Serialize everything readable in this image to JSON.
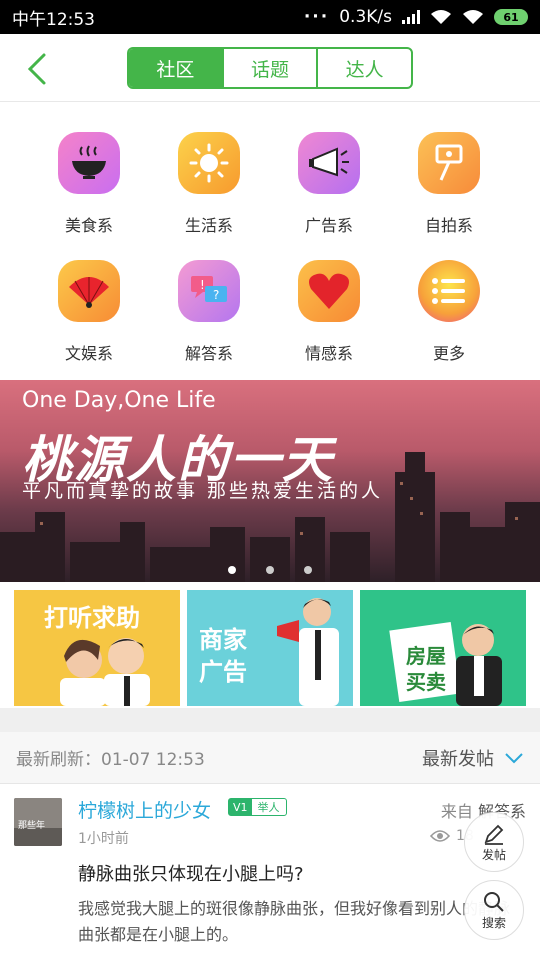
{
  "status_bar": {
    "time": "中午12:53",
    "dots": "···",
    "speed": "0.3K/s",
    "battery": "61"
  },
  "header": {
    "tabs": [
      "社区",
      "话题",
      "达人"
    ],
    "active_tab": "社区"
  },
  "categories": [
    {
      "label": "美食系",
      "icon": "food-bowl-icon"
    },
    {
      "label": "生活系",
      "icon": "sun-icon"
    },
    {
      "label": "广告系",
      "icon": "megaphone-icon"
    },
    {
      "label": "自拍系",
      "icon": "selfie-stick-icon"
    },
    {
      "label": "文娱系",
      "icon": "fan-icon"
    },
    {
      "label": "解答系",
      "icon": "chat-bubbles-icon"
    },
    {
      "label": "情感系",
      "icon": "heart-icon"
    },
    {
      "label": "更多",
      "icon": "list-icon"
    }
  ],
  "banner": {
    "title_en": "One Day,One Life",
    "title_cn": "桃源人的一天",
    "subtitle": "平凡而真挚的故事  那些热爱生活的人",
    "pages": 3,
    "active_page": 1
  },
  "promos": [
    {
      "label": "打听求助"
    },
    {
      "label_line1": "商家",
      "label_line2": "广告"
    },
    {
      "label_line1": "房屋",
      "label_line2": "买卖"
    }
  ],
  "feed_header": {
    "refresh_label": "最新刷新：01-07 12:53",
    "sort_label": "最新发帖"
  },
  "post": {
    "author": "柠檬树上的少女",
    "level": "V1",
    "tag": "举人",
    "from_prefix": "来自",
    "from_section": "解答系",
    "time": "1小时前",
    "views": "18",
    "title": "静脉曲张只体现在小腿上吗?",
    "body": "我感觉我大腿上的斑很像静脉曲张，但我好像看到别人的静脉曲张都是在小腿上的。",
    "avatar_caption": "那些年"
  },
  "fabs": {
    "post_label": "发帖",
    "search_label": "搜索"
  },
  "colors": {
    "accent_green": "#44b549",
    "username_blue": "#2ba8d9"
  }
}
